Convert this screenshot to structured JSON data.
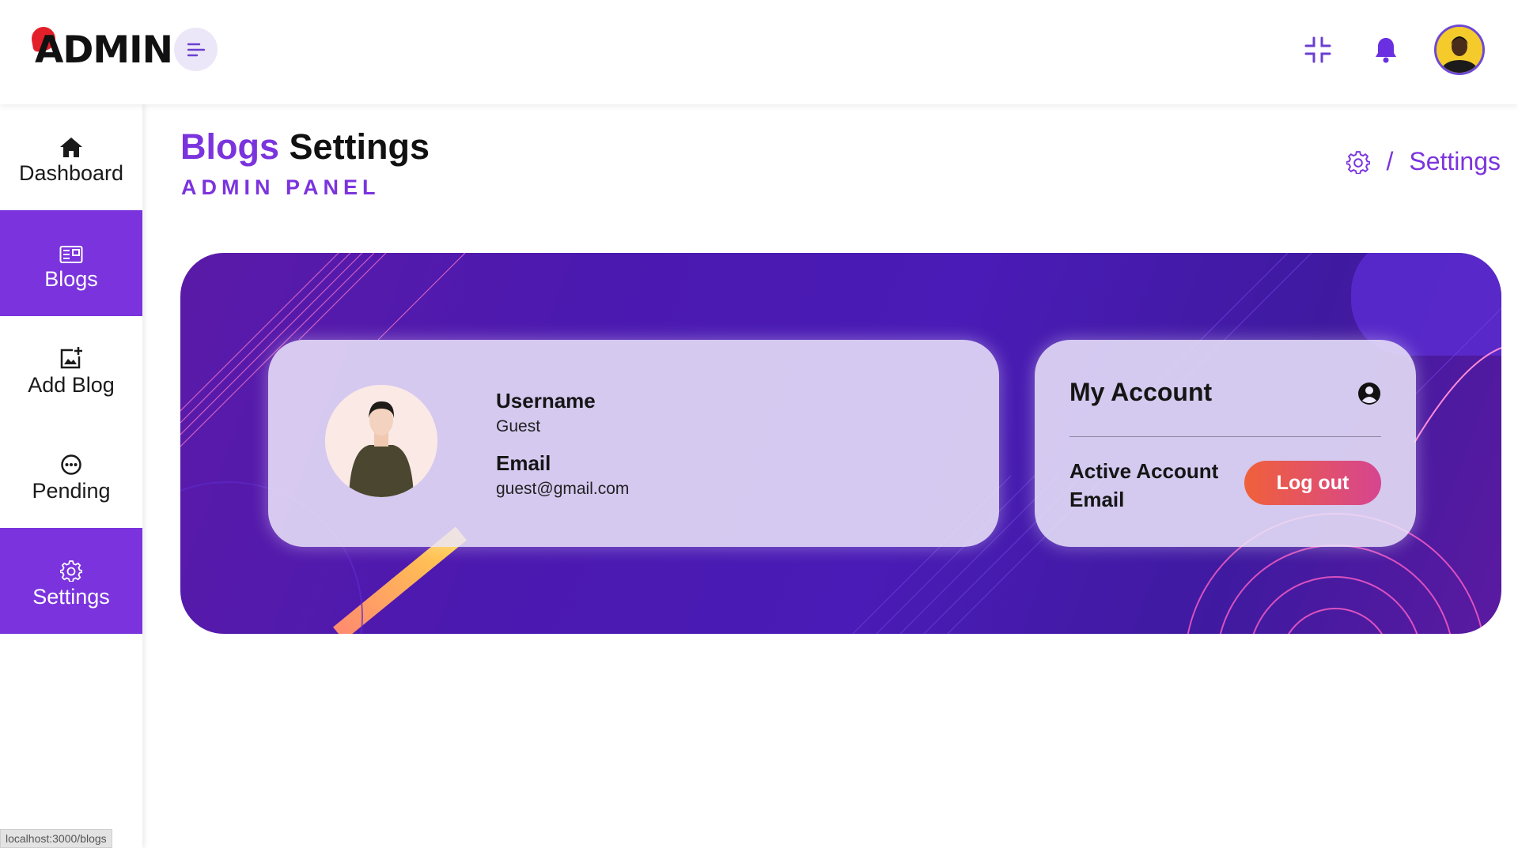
{
  "header": {
    "logo_text": "ADMIN",
    "menu_toggle_icon": "menu-lines-icon",
    "icons": [
      "fullscreen-exit-icon",
      "bell-icon",
      "user-avatar"
    ]
  },
  "sidebar": {
    "items": [
      {
        "label": "Dashboard",
        "icon": "home-icon",
        "active": false
      },
      {
        "label": "Blogs",
        "icon": "newspaper-icon",
        "active": true
      },
      {
        "label": "Add Blog",
        "icon": "add-image-icon",
        "active": false
      },
      {
        "label": "Pending",
        "icon": "pending-icon",
        "active": false
      },
      {
        "label": "Settings",
        "icon": "gear-icon",
        "active": true
      }
    ]
  },
  "page": {
    "title_accent": "Blogs",
    "title_rest": "Settings",
    "subtitle": "ADMIN PANEL",
    "breadcrumb": {
      "icon": "gear-icon",
      "separator": "/",
      "current": "Settings"
    }
  },
  "profile": {
    "username_label": "Username",
    "username_value": "Guest",
    "email_label": "Email",
    "email_value": "guest@gmail.com"
  },
  "account": {
    "title": "My Account",
    "icon": "user-circle-icon",
    "status_text": "Active Account Email",
    "logout_label": "Log out"
  },
  "status_bar": {
    "url": "localhost:3000/blogs"
  },
  "colors": {
    "accent": "#7b34dd",
    "banner": "#4a1bb6",
    "logout_start": "#f0603a",
    "logout_end": "#d64590"
  }
}
